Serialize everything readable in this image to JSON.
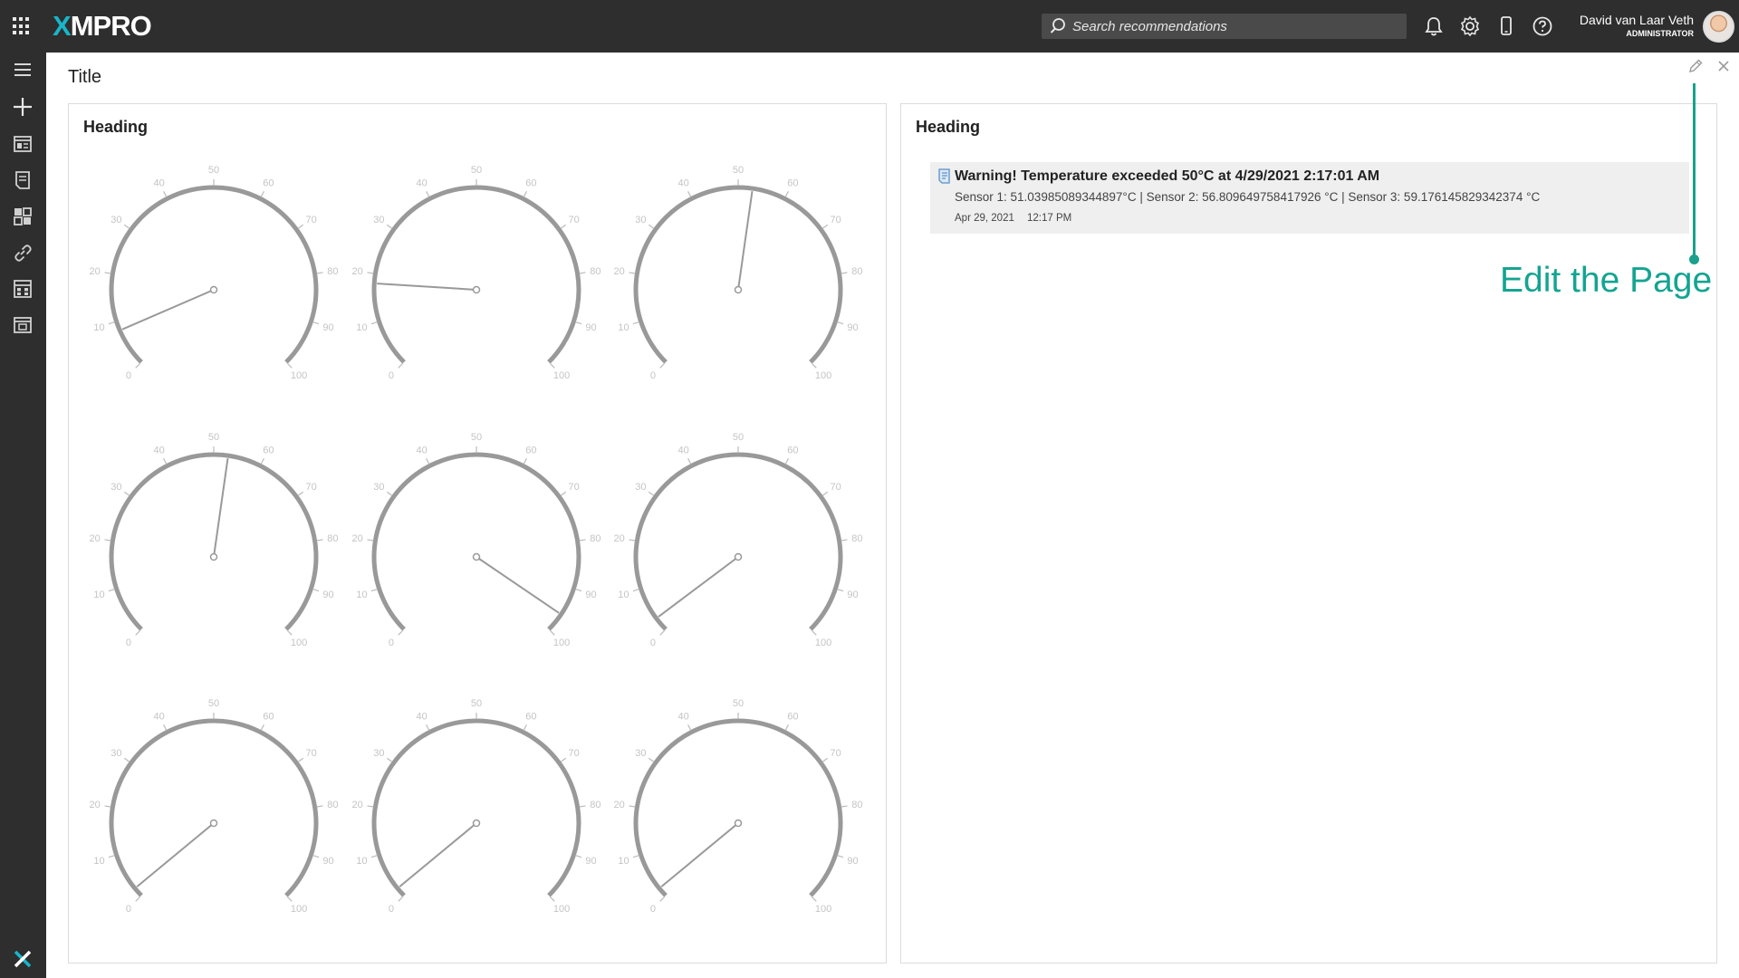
{
  "app": {
    "logo_text": "XMPRO",
    "accent_color": "#19b5c9"
  },
  "header": {
    "search_placeholder": "Search recommendations",
    "icons": [
      "bell-icon",
      "gear-icon",
      "mobile-icon",
      "help-icon"
    ],
    "user_name": "David van Laar Veth",
    "user_role": "ADMINISTRATOR"
  },
  "sidebar": {
    "items": [
      "menu-icon",
      "add-icon",
      "app-designer-icon",
      "recommendations-icon",
      "data-streams-icon",
      "integrations-icon",
      "dashboard-icon",
      "layout-icon"
    ]
  },
  "page": {
    "title": "Title"
  },
  "left_panel": {
    "heading": "Heading"
  },
  "gauges": {
    "min": 0,
    "max": 100,
    "tick_labels": [
      "0",
      "10",
      "20",
      "30",
      "40",
      "50",
      "60",
      "70",
      "80",
      "90",
      "100"
    ],
    "values": [
      8,
      18,
      53,
      53,
      96,
      3,
      2,
      2,
      2
    ]
  },
  "right_panel": {
    "heading": "Heading",
    "notification": {
      "title": "Warning! Temperature exceeded 50°C at 4/29/2021 2:17:01 AM",
      "body": "Sensor 1: 51.03985089344897°C | Sensor 2: 56.809649758417926 °C | Sensor 3: 59.176145829342374 °C",
      "date": "Apr 29, 2021",
      "time": "12:17 PM"
    }
  },
  "annotation": {
    "text": "Edit the Page",
    "color": "#14a491"
  }
}
